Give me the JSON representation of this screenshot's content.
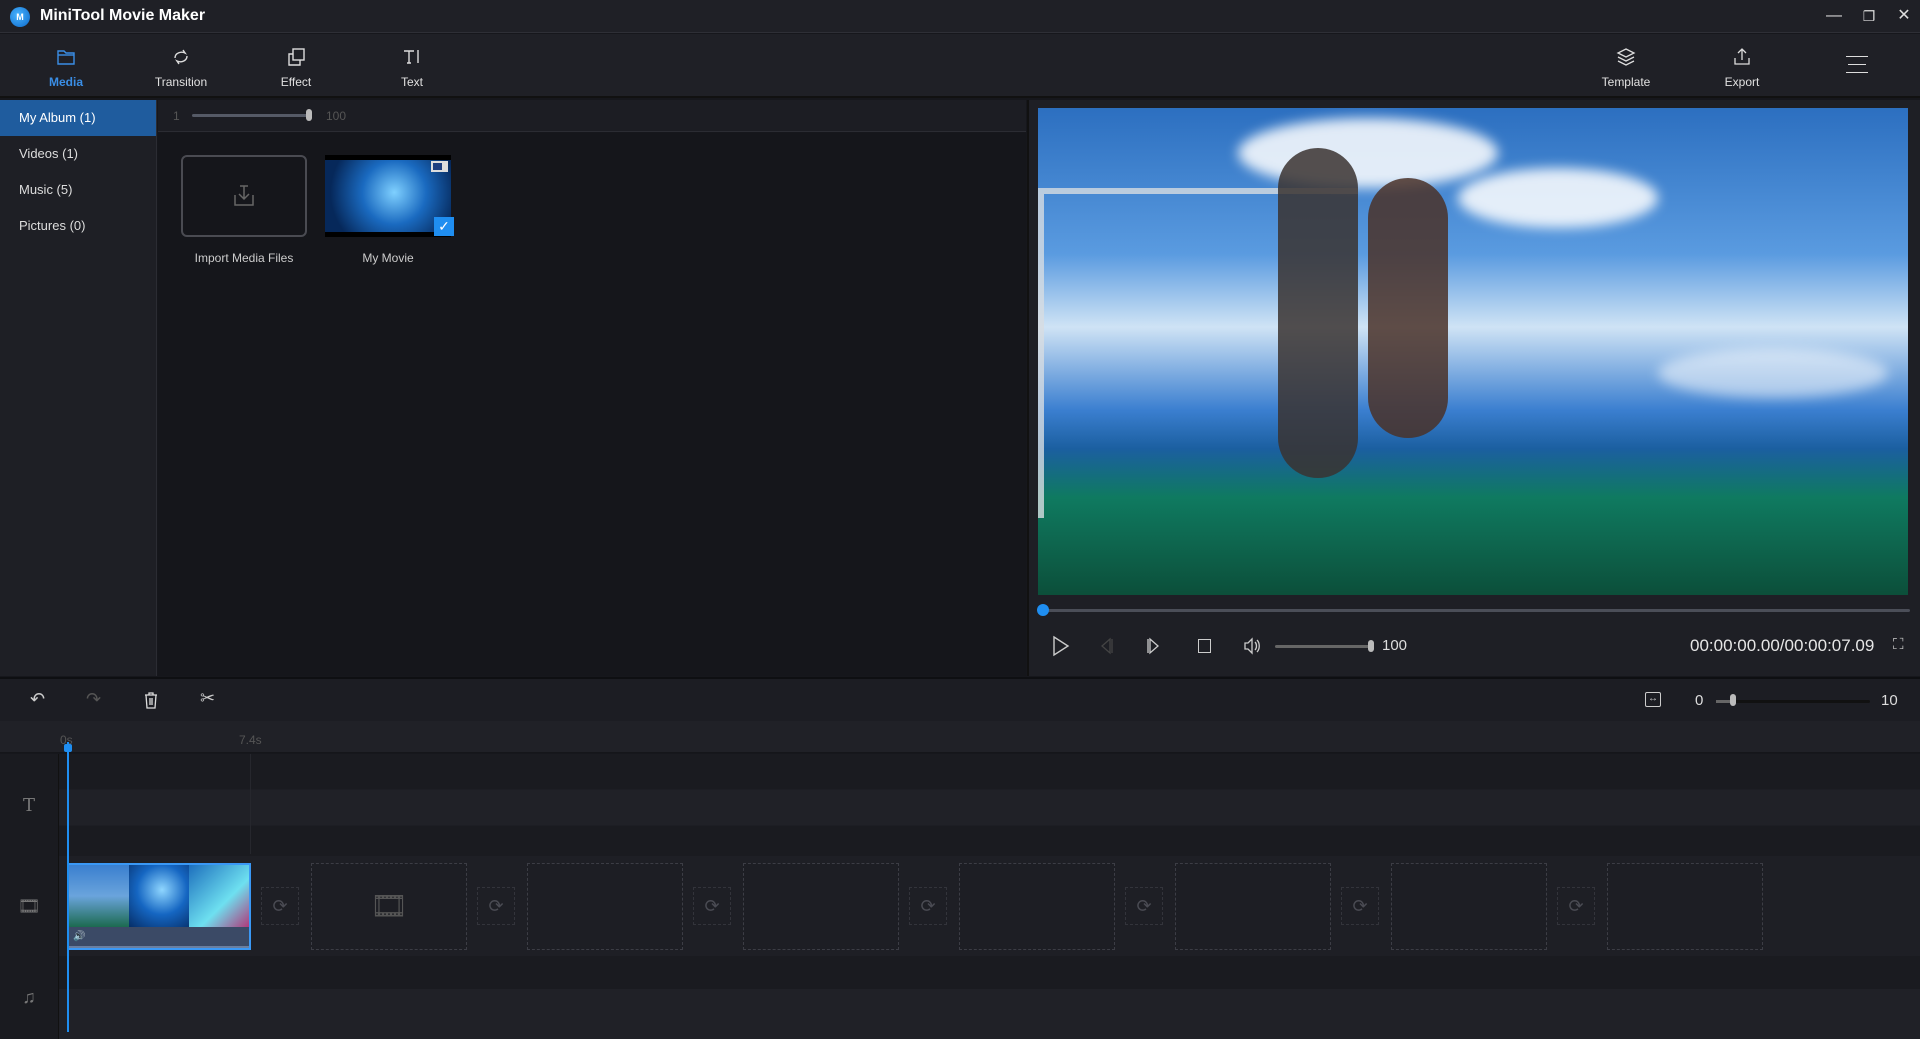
{
  "app": {
    "title": "MiniTool Movie Maker",
    "logo_text": "M"
  },
  "window": {
    "minimize": "—",
    "restore": "❐",
    "close": "✕"
  },
  "toolbar": {
    "tabs": [
      {
        "label": "Media",
        "icon": "folder-icon",
        "active": true
      },
      {
        "label": "Transition",
        "icon": "transition-icon"
      },
      {
        "label": "Effect",
        "icon": "effect-icon"
      },
      {
        "label": "Text",
        "icon": "text-icon"
      }
    ],
    "right": [
      {
        "label": "Template",
        "icon": "layers-icon"
      },
      {
        "label": "Export",
        "icon": "export-icon"
      }
    ],
    "menu_icon": "hamburger-menu-icon"
  },
  "sidebar": {
    "items": [
      {
        "label": "My Album  (1)",
        "active": true
      },
      {
        "label": "Videos  (1)"
      },
      {
        "label": "Music  (5)"
      },
      {
        "label": "Pictures  (0)"
      }
    ]
  },
  "media": {
    "zoom_min": "1",
    "zoom_max": "100",
    "zoom_value": 100,
    "items": [
      {
        "label": "Import Media Files",
        "type": "import"
      },
      {
        "label": "My Movie",
        "type": "video",
        "selected": true
      }
    ]
  },
  "player": {
    "progress": 0,
    "volume": 100,
    "volume_label": "100",
    "time": "00:00:00.00/00:00:07.09"
  },
  "timeline": {
    "zoom_min": "0",
    "zoom_max": "10",
    "zoom_value": 1,
    "ruler": [
      "0s",
      "7.4s"
    ],
    "empty_slots": 7
  },
  "colors": {
    "accent": "#1f8ef1",
    "background": "#16171c",
    "panel": "#1e1f25"
  }
}
